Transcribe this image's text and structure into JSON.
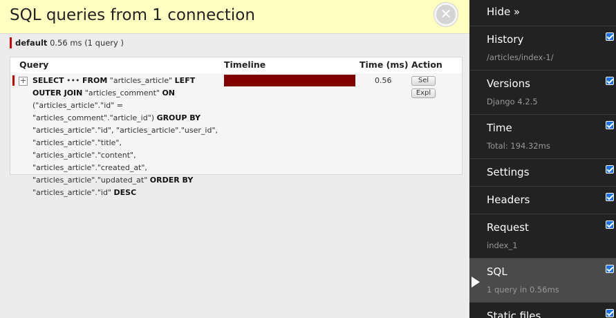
{
  "panel": {
    "title": "SQL queries from 1 connection",
    "close_icon": "close-icon",
    "connection": {
      "alias": "default",
      "summary": "0.56 ms (1 query )"
    },
    "table": {
      "headers": {
        "query": "Query",
        "timeline": "Timeline",
        "time": "Time (ms)",
        "action": "Action"
      },
      "rows": [
        {
          "sql_parts": [
            [
              "kw",
              "SELECT"
            ],
            [
              "txt",
              " ••• "
            ],
            [
              "kw",
              "FROM"
            ],
            [
              "txt",
              " \"articles_article\" "
            ],
            [
              "kw",
              "LEFT OUTER JOIN"
            ],
            [
              "txt",
              " \"articles_comment\" "
            ],
            [
              "kw",
              "ON"
            ],
            [
              "txt",
              " (\"articles_article\".\"id\" = \"articles_comment\".\"article_id\") "
            ],
            [
              "kw",
              "GROUP BY"
            ],
            [
              "txt",
              " \"articles_article\".\"id\", \"articles_article\".\"user_id\", \"articles_article\".\"title\", \"articles_article\".\"content\", \"articles_article\".\"created_at\", \"articles_article\".\"updated_at\" "
            ],
            [
              "kw",
              "ORDER BY"
            ],
            [
              "txt",
              " \"articles_article\".\"id\" "
            ],
            [
              "kw",
              "DESC"
            ]
          ],
          "timeline_fraction": 1.0,
          "time_ms": "0.56",
          "actions": {
            "select": "Sel",
            "explain": "Expl"
          },
          "toggle": "+"
        }
      ]
    }
  },
  "toolbar": {
    "hide": "Hide »",
    "items": [
      {
        "label": "History",
        "sub": "/articles/index-1/"
      },
      {
        "label": "Versions",
        "sub": "Django 4.2.5"
      },
      {
        "label": "Time",
        "sub": "Total: 194.32ms"
      },
      {
        "label": "Settings",
        "sub": ""
      },
      {
        "label": "Headers",
        "sub": ""
      },
      {
        "label": "Request",
        "sub": "index_1"
      },
      {
        "label": "SQL",
        "sub": "1 query in 0.56ms"
      },
      {
        "label": "Static files",
        "sub": ""
      }
    ],
    "accent": "#1a73e8"
  }
}
